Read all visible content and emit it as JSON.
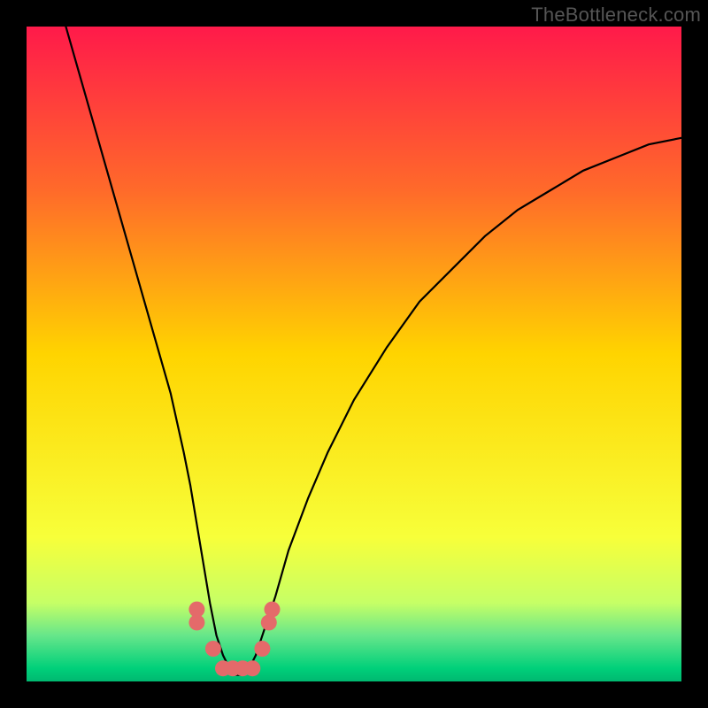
{
  "watermark": "TheBottleneck.com",
  "chart_data": {
    "type": "line",
    "title": "",
    "xlabel": "",
    "ylabel": "",
    "xlim": [
      0,
      100
    ],
    "ylim": [
      0,
      100
    ],
    "grid": false,
    "legend": false,
    "background_gradient": {
      "stops": [
        {
          "offset": 0.0,
          "color": "#ff1a4a"
        },
        {
          "offset": 0.25,
          "color": "#ff6a2a"
        },
        {
          "offset": 0.5,
          "color": "#ffd400"
        },
        {
          "offset": 0.78,
          "color": "#f7ff3a"
        },
        {
          "offset": 0.88,
          "color": "#c6ff66"
        },
        {
          "offset": 0.93,
          "color": "#66e68a"
        },
        {
          "offset": 0.98,
          "color": "#00d07a"
        },
        {
          "offset": 1.0,
          "color": "#00b870"
        }
      ]
    },
    "series": [
      {
        "name": "bottleneck-curve",
        "color": "#000000",
        "x": [
          6,
          8,
          10,
          12,
          14,
          16,
          18,
          20,
          22,
          24,
          25,
          26,
          27,
          28,
          29,
          30,
          31,
          32,
          33,
          34,
          35,
          36,
          38,
          40,
          43,
          46,
          50,
          55,
          60,
          65,
          70,
          75,
          80,
          85,
          90,
          95,
          100
        ],
        "y": [
          100,
          93,
          86,
          79,
          72,
          65,
          58,
          51,
          44,
          35,
          30,
          24,
          18,
          12,
          7,
          4,
          2,
          1,
          1,
          2,
          4,
          7,
          13,
          20,
          28,
          35,
          43,
          51,
          58,
          63,
          68,
          72,
          75,
          78,
          80,
          82,
          83
        ]
      }
    ],
    "markers": {
      "name": "highlight-dots",
      "color": "#e46a6a",
      "radius": 9,
      "points": [
        {
          "x": 26,
          "y": 11
        },
        {
          "x": 26,
          "y": 9
        },
        {
          "x": 28.5,
          "y": 5
        },
        {
          "x": 30,
          "y": 2
        },
        {
          "x": 31.5,
          "y": 2
        },
        {
          "x": 33,
          "y": 2
        },
        {
          "x": 34.5,
          "y": 2
        },
        {
          "x": 36,
          "y": 5
        },
        {
          "x": 37,
          "y": 9
        },
        {
          "x": 37.5,
          "y": 11
        }
      ]
    }
  }
}
